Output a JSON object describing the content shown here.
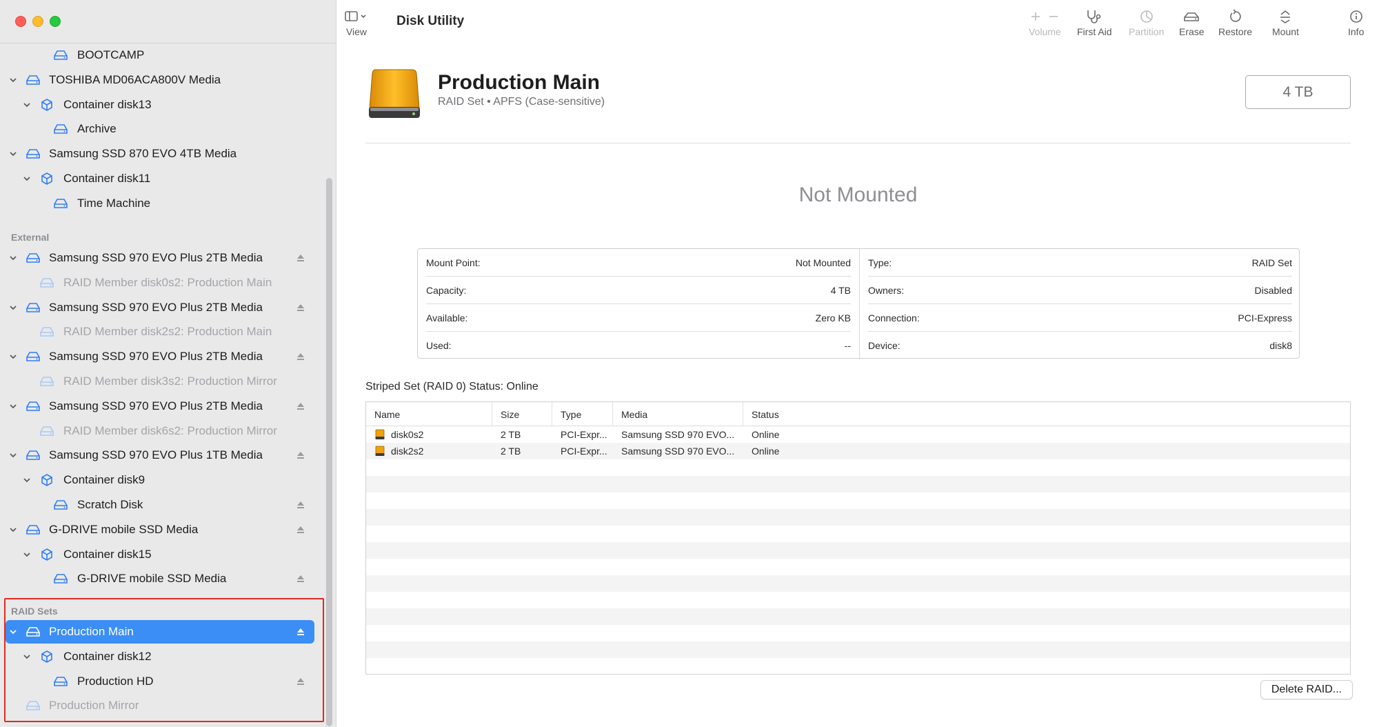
{
  "window": {
    "title": "Disk Utility"
  },
  "toolbar": {
    "view_label": "View",
    "volume_label": "Volume",
    "first_aid_label": "First Aid",
    "partition_label": "Partition",
    "erase_label": "Erase",
    "restore_label": "Restore",
    "mount_label": "Mount",
    "info_label": "Info"
  },
  "sidebar": {
    "internal_items": [
      {
        "label": "BOOTCAMP",
        "level": 2,
        "icon": "volume-icon",
        "chevron": false,
        "eject": false,
        "dim": false
      },
      {
        "label": "TOSHIBA MD06ACA800V Media",
        "level": 0,
        "icon": "drive-icon",
        "chevron": true,
        "eject": false,
        "dim": false
      },
      {
        "label": "Container disk13",
        "level": 1,
        "icon": "container-icon",
        "chevron": true,
        "eject": false,
        "dim": false
      },
      {
        "label": "Archive",
        "level": 2,
        "icon": "volume-icon",
        "chevron": false,
        "eject": false,
        "dim": false
      },
      {
        "label": "Samsung SSD 870 EVO 4TB Media",
        "level": 0,
        "icon": "drive-icon",
        "chevron": true,
        "eject": false,
        "dim": false
      },
      {
        "label": "Container disk11",
        "level": 1,
        "icon": "container-icon",
        "chevron": true,
        "eject": false,
        "dim": false
      },
      {
        "label": "Time Machine",
        "level": 2,
        "icon": "volume-icon",
        "chevron": false,
        "eject": false,
        "dim": false
      }
    ],
    "external_label": "External",
    "external_items": [
      {
        "label": "Samsung SSD 970 EVO Plus 2TB Media",
        "level": 0,
        "icon": "drive-icon",
        "chevron": true,
        "eject": true,
        "dim": false
      },
      {
        "label": "RAID Member disk0s2: Production Main",
        "level": 1,
        "icon": "volume-icon",
        "chevron": false,
        "eject": false,
        "dim": true
      },
      {
        "label": "Samsung SSD 970 EVO Plus 2TB Media",
        "level": 0,
        "icon": "drive-icon",
        "chevron": true,
        "eject": true,
        "dim": false
      },
      {
        "label": "RAID Member disk2s2: Production Main",
        "level": 1,
        "icon": "volume-icon",
        "chevron": false,
        "eject": false,
        "dim": true
      },
      {
        "label": "Samsung SSD 970 EVO Plus 2TB Media",
        "level": 0,
        "icon": "drive-icon",
        "chevron": true,
        "eject": true,
        "dim": false
      },
      {
        "label": "RAID Member disk3s2: Production Mirror",
        "level": 1,
        "icon": "volume-icon",
        "chevron": false,
        "eject": false,
        "dim": true
      },
      {
        "label": "Samsung SSD 970 EVO Plus 2TB Media",
        "level": 0,
        "icon": "drive-icon",
        "chevron": true,
        "eject": true,
        "dim": false
      },
      {
        "label": "RAID Member disk6s2: Production Mirror",
        "level": 1,
        "icon": "volume-icon",
        "chevron": false,
        "eject": false,
        "dim": true
      },
      {
        "label": "Samsung SSD 970 EVO Plus 1TB Media",
        "level": 0,
        "icon": "drive-icon",
        "chevron": true,
        "eject": true,
        "dim": false
      },
      {
        "label": "Container disk9",
        "level": 1,
        "icon": "container-icon",
        "chevron": true,
        "eject": false,
        "dim": false
      },
      {
        "label": "Scratch Disk",
        "level": 2,
        "icon": "volume-icon",
        "chevron": false,
        "eject": true,
        "dim": false
      },
      {
        "label": "G-DRIVE mobile SSD Media",
        "level": 0,
        "icon": "drive-icon",
        "chevron": true,
        "eject": true,
        "dim": false
      },
      {
        "label": "Container disk15",
        "level": 1,
        "icon": "container-icon",
        "chevron": true,
        "eject": false,
        "dim": false
      },
      {
        "label": "G-DRIVE mobile SSD Media",
        "level": 2,
        "icon": "volume-icon",
        "chevron": false,
        "eject": true,
        "dim": false
      }
    ],
    "raid_label": "RAID Sets",
    "raid_items": [
      {
        "label": "Production Main",
        "level": 0,
        "icon": "drive-icon",
        "chevron": true,
        "eject": true,
        "dim": false,
        "selected": true
      },
      {
        "label": "Container disk12",
        "level": 1,
        "icon": "container-icon",
        "chevron": true,
        "eject": false,
        "dim": false
      },
      {
        "label": "Production HD",
        "level": 2,
        "icon": "volume-icon",
        "chevron": false,
        "eject": true,
        "dim": false
      },
      {
        "label": "Production Mirror",
        "level": 0,
        "icon": "drive-icon",
        "chevron": false,
        "eject": false,
        "dim": true
      }
    ]
  },
  "disk": {
    "name": "Production Main",
    "subtitle": "RAID Set • APFS (Case-sensitive)",
    "capacity": "4 TB",
    "mount_status": "Not Mounted"
  },
  "info": {
    "left": [
      {
        "key": "Mount Point:",
        "value": "Not Mounted"
      },
      {
        "key": "Capacity:",
        "value": "4 TB"
      },
      {
        "key": "Available:",
        "value": "Zero KB"
      },
      {
        "key": "Used:",
        "value": "--"
      }
    ],
    "right": [
      {
        "key": "Type:",
        "value": "RAID Set"
      },
      {
        "key": "Owners:",
        "value": "Disabled"
      },
      {
        "key": "Connection:",
        "value": "PCI-Express"
      },
      {
        "key": "Device:",
        "value": "disk8"
      }
    ]
  },
  "raid_set": {
    "status_text": "Striped Set (RAID 0) Status: Online",
    "columns": [
      "Name",
      "Size",
      "Type",
      "Media",
      "Status"
    ],
    "members": [
      {
        "name": "disk0s2",
        "size": "2 TB",
        "type": "PCI-Expr...",
        "media": "Samsung SSD 970 EVO...",
        "status": "Online"
      },
      {
        "name": "disk2s2",
        "size": "2 TB",
        "type": "PCI-Expr...",
        "media": "Samsung SSD 970 EVO...",
        "status": "Online"
      }
    ],
    "delete_button": "Delete RAID..."
  },
  "colors": {
    "accent": "#3b8ef5",
    "highlight_border": "#e0291e",
    "sidebar_icon": "#2f7df6",
    "disk_icon": "#f0a20a"
  }
}
